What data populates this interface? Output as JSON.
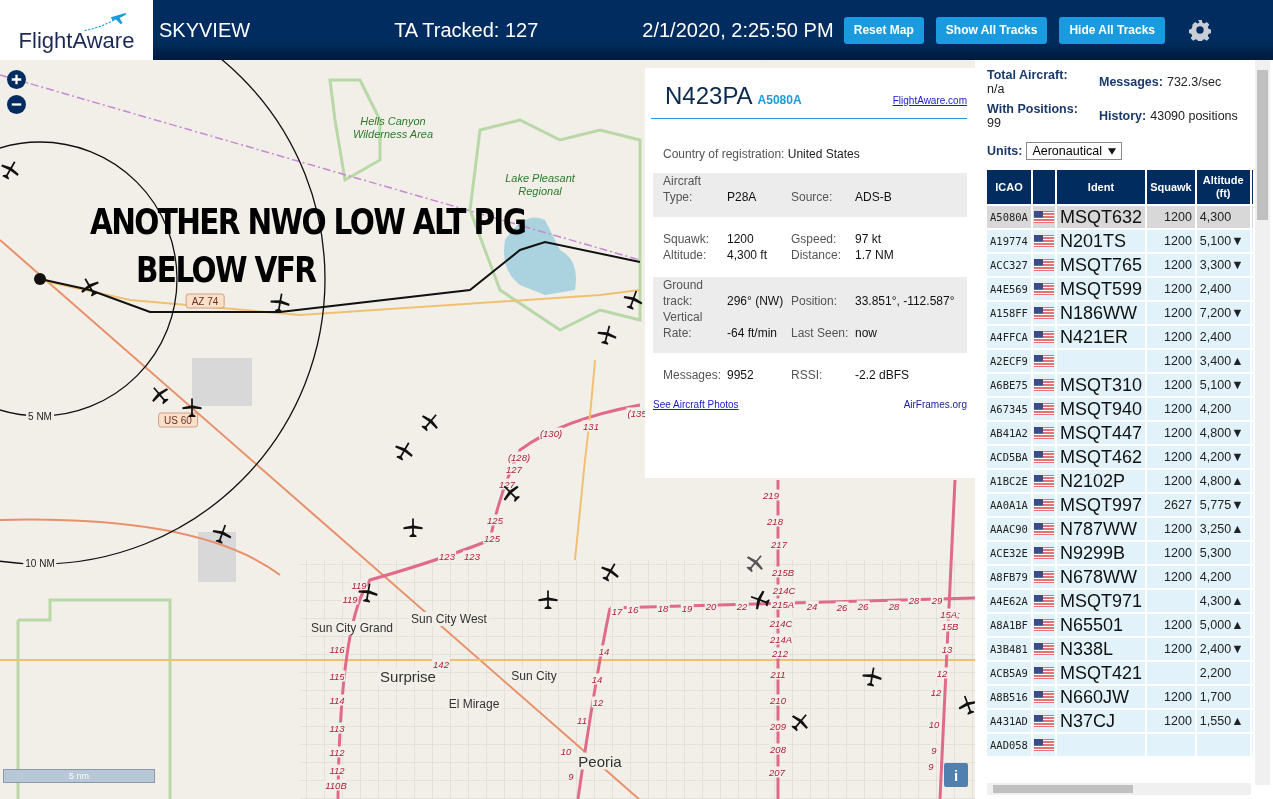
{
  "header": {
    "logo": "FlightAware",
    "title": "SKYVIEW",
    "tracked": "TA Tracked: 127",
    "datetime": "2/1/2020, 2:25:50 PM",
    "buttons": [
      "Reset Map",
      "Show All Tracks",
      "Hide All Tracks"
    ]
  },
  "map": {
    "annotation": [
      "ANOTHER NWO LOW ALT PIG",
      "BELOW VFR"
    ],
    "places": [
      {
        "text": "Hells Canyon Wilderness Area",
        "kind": "park"
      },
      {
        "text": "Lake Pleasant Regional",
        "kind": "park"
      },
      {
        "text": "Sun City Grand",
        "kind": "town"
      },
      {
        "text": "Sun City West",
        "kind": "town"
      },
      {
        "text": "Surprise",
        "kind": "city"
      },
      {
        "text": "Sun City",
        "kind": "town"
      },
      {
        "text": "El Mirage",
        "kind": "town"
      },
      {
        "text": "Peoria",
        "kind": "city"
      }
    ],
    "shields": [
      "AZ 74",
      "US 60"
    ],
    "ranges": [
      "5 NM",
      "10 NM"
    ],
    "exits": [
      "(135",
      "131",
      "(130)",
      "(128)",
      "127",
      "127",
      "125",
      "125",
      "123",
      "123",
      "119",
      "119",
      "116",
      "115",
      "114",
      "113",
      "112",
      "112",
      "110B",
      "142",
      "17",
      "16",
      "18",
      "19",
      "20",
      "22",
      "24",
      "26",
      "26",
      "28",
      "28",
      "29",
      "219",
      "218",
      "217",
      "215B",
      "214C",
      "215A",
      "214C",
      "214A",
      "212",
      "211",
      "210",
      "209",
      "208",
      "207",
      "14",
      "14",
      "12",
      "11",
      "10",
      "9",
      "15A;",
      "15B",
      "13",
      "12",
      "12",
      "10",
      "9",
      "9"
    ],
    "scale": "5 nm",
    "info": "i"
  },
  "popup": {
    "ident": "N423PA",
    "icao": "A5080A",
    "link": "FlightAware.com",
    "country_label": "Country of registration:",
    "country": "United States",
    "sections": [
      {
        "shaded": true,
        "fields": [
          {
            "label": "Aircraft Type:",
            "value": "P28A"
          },
          {
            "label": "Source:",
            "value": "ADS-B"
          }
        ]
      },
      {
        "shaded": false,
        "fields": [
          {
            "label": "Squawk:",
            "value": "1200"
          },
          {
            "label": "Gspeed:",
            "value": "97 kt"
          },
          {
            "label": "Altitude:",
            "value": "4,300 ft"
          },
          {
            "label": "Distance:",
            "value": "1.7 NM"
          }
        ]
      },
      {
        "shaded": true,
        "fields": [
          {
            "label": "Ground track:",
            "value": "296° (NW)"
          },
          {
            "label": "Position:",
            "value": "33.851°, -112.587°"
          },
          {
            "label": "Vertical Rate:",
            "value": "-64 ft/min"
          },
          {
            "label": "Last Seen:",
            "value": "now"
          }
        ]
      },
      {
        "shaded": false,
        "fields": [
          {
            "label": "Messages:",
            "value": "9952"
          },
          {
            "label": "RSSI:",
            "value": "-2.2 dBFS"
          }
        ]
      }
    ],
    "photos_link": "See Aircraft Photos",
    "airframes_link": "AirFrames.org"
  },
  "stats": [
    {
      "label": "Total Aircraft:",
      "value": "n/a"
    },
    {
      "label": "Messages:",
      "value": "732.3/sec"
    },
    {
      "label": "With Positions:",
      "value": "99"
    },
    {
      "label": "History:",
      "value": "43090 positions"
    }
  ],
  "units": {
    "label": "Units:",
    "value": "Aeronautical"
  },
  "table": {
    "columns": [
      "ICAO",
      "",
      "Ident",
      "Squawk",
      "Altitude (ft)"
    ],
    "rows": [
      {
        "icao": "A5080A",
        "ident": "MSQT632",
        "squawk": "1200",
        "altitude": "4,300",
        "selected": true
      },
      {
        "icao": "A19774",
        "ident": "N201TS",
        "squawk": "1200",
        "altitude": "5,100",
        "trend": "▼",
        "selected": false
      },
      {
        "icao": "ACC327",
        "ident": "MSQT765",
        "squawk": "1200",
        "altitude": "3,300",
        "trend": "▼",
        "selected": false
      },
      {
        "icao": "A4E569",
        "ident": "MSQT599",
        "squawk": "1200",
        "altitude": "2,400",
        "selected": false
      },
      {
        "icao": "A158FF",
        "ident": "N186WW",
        "squawk": "1200",
        "altitude": "7,200",
        "trend": "▼",
        "selected": false
      },
      {
        "icao": "A4FFCA",
        "ident": "N421ER",
        "squawk": "1200",
        "altitude": "2,400",
        "selected": false
      },
      {
        "icao": "A2ECF9",
        "squawk": "1200",
        "altitude": "3,400",
        "trend": "▲",
        "selected": false
      },
      {
        "icao": "A6BE75",
        "ident": "MSQT310",
        "squawk": "1200",
        "altitude": "5,100",
        "trend": "▼",
        "selected": false
      },
      {
        "icao": "A67345",
        "ident": "MSQT940",
        "squawk": "1200",
        "altitude": "4,200",
        "selected": false
      },
      {
        "icao": "AB41A2",
        "ident": "MSQT447",
        "squawk": "1200",
        "altitude": "4,800",
        "trend": "▼",
        "selected": false
      },
      {
        "icao": "ACD5BA",
        "ident": "MSQT462",
        "squawk": "1200",
        "altitude": "4,200",
        "trend": "▼",
        "selected": false
      },
      {
        "icao": "A1BC2E",
        "ident": "N2102P",
        "squawk": "1200",
        "altitude": "4,800",
        "trend": "▲",
        "selected": false
      },
      {
        "icao": "AA0A1A",
        "ident": "MSQT997",
        "squawk": "2627",
        "altitude": "5,775",
        "trend": "▼",
        "selected": false
      },
      {
        "icao": "AAAC90",
        "ident": "N787WW",
        "squawk": "1200",
        "altitude": "3,250",
        "trend": "▲",
        "selected": false
      },
      {
        "icao": "ACE32E",
        "ident": "N9299B",
        "squawk": "1200",
        "altitude": "5,300",
        "selected": false
      },
      {
        "icao": "A8FB79",
        "ident": "N678WW",
        "squawk": "1200",
        "altitude": "4,200",
        "selected": false
      },
      {
        "icao": "A4E62A",
        "ident": "MSQT971",
        "altitude": "4,300",
        "trend": "▲",
        "selected": false
      },
      {
        "icao": "A8A1BF",
        "ident": "N65501",
        "squawk": "1200",
        "altitude": "5,000",
        "trend": "▲",
        "selected": false
      },
      {
        "icao": "A3B481",
        "ident": "N338L",
        "squawk": "1200",
        "altitude": "2,400",
        "trend": "▼",
        "selected": false
      },
      {
        "icao": "ACB5A9",
        "ident": "MSQT421",
        "altitude": "2,200",
        "selected": false
      },
      {
        "icao": "A8B516",
        "ident": "N660JW",
        "squawk": "1200",
        "altitude": "1,700",
        "selected": false
      },
      {
        "icao": "A431AD",
        "ident": "N37CJ",
        "squawk": "1200",
        "altitude": "1,550",
        "trend": "▲",
        "selected": false
      },
      {
        "icao": "AAD058",
        "selected": false
      }
    ]
  }
}
